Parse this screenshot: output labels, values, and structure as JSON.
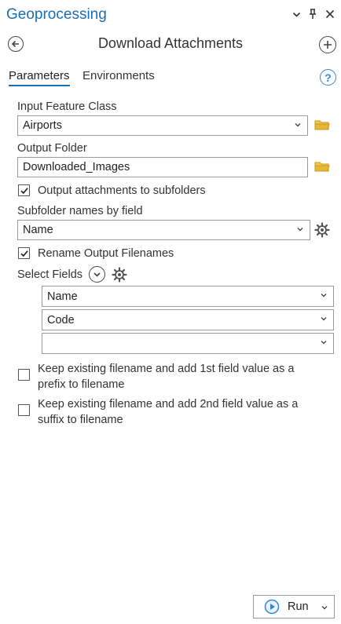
{
  "pane": {
    "title": "Geoprocessing"
  },
  "tool": {
    "title": "Download Attachments"
  },
  "tabs": [
    {
      "label": "Parameters",
      "active": true
    },
    {
      "label": "Environments",
      "active": false
    }
  ],
  "params": {
    "input_feature_class": {
      "label": "Input Feature Class",
      "value": "Airports"
    },
    "output_folder": {
      "label": "Output Folder",
      "value": "Downloaded_Images"
    },
    "output_to_subfolders": {
      "label": "Output attachments to subfolders",
      "checked": true
    },
    "subfolder_names": {
      "label": "Subfolder names by field",
      "value": "Name"
    },
    "rename_output": {
      "label": "Rename Output Filenames",
      "checked": true
    },
    "select_fields": {
      "label": "Select Fields",
      "values": [
        "Name",
        "Code",
        ""
      ]
    },
    "prefix_option": {
      "label_line1": "Keep existing filename and add 1st field value as a",
      "label_line2": "prefix to filename",
      "checked": false
    },
    "suffix_option": {
      "label_line1": "Keep existing filename and add 2nd field value as a",
      "label_line2": "suffix to filename",
      "checked": false
    }
  },
  "footer": {
    "run_label": "Run"
  },
  "colors": {
    "accent": "#1a6fb4",
    "folder": "#e8b73a",
    "run_icon": "#2f87d2"
  }
}
